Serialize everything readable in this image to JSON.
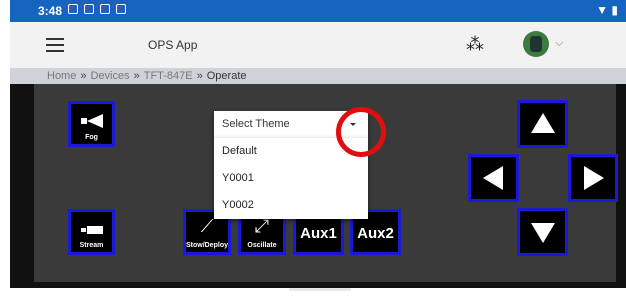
{
  "status": {
    "time": "3:48"
  },
  "app": {
    "title": "OPS App"
  },
  "breadcrumb": {
    "home": "Home",
    "devices": "Devices",
    "device": "TFT-847E",
    "current": "Operate",
    "sep": "»"
  },
  "buttons": {
    "fog": "Fog",
    "stream": "Stream",
    "stow_deploy": "Stow/Deploy",
    "oscillate": "Oscillate",
    "aux1": "Aux1",
    "aux2": "Aux2"
  },
  "dropdown": {
    "placeholder": "Select Theme",
    "options": [
      "Default",
      "Y0001",
      "Y0002"
    ]
  },
  "colors": {
    "accent": "#1565c0",
    "button_border": "#1a1ad6",
    "highlight": "#e10e0e",
    "panel": "#3a3a3a"
  },
  "icons": [
    "menu-icon",
    "bluetooth-icon",
    "avatar",
    "chevron-down-icon",
    "fog-nozzle-icon",
    "stream-nozzle-icon",
    "stow-deploy-icon",
    "oscillate-icon",
    "arrow-up-icon",
    "arrow-down-icon",
    "arrow-left-icon",
    "arrow-right-icon"
  ]
}
